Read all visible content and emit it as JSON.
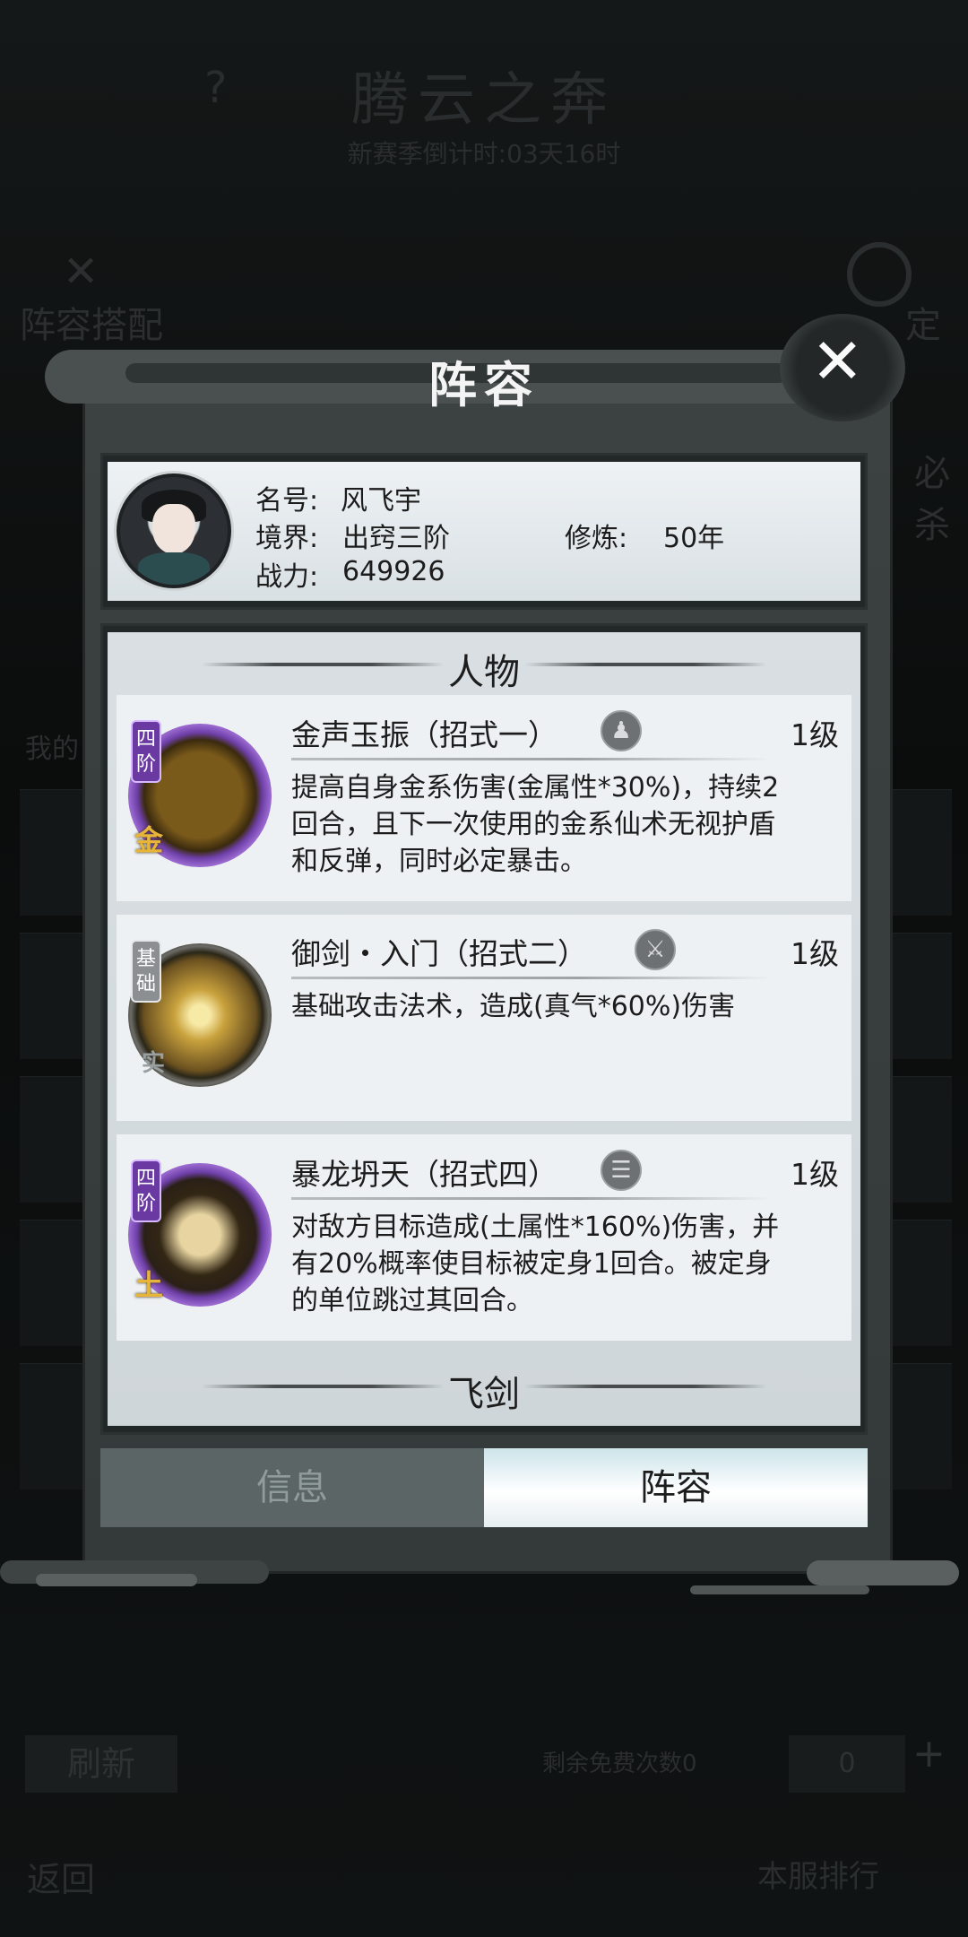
{
  "background": {
    "title": "腾云之奔",
    "question_mark": "?",
    "countdown": "新赛季倒计时:03天16时",
    "lineup_button": "阵容搭配",
    "right_label_1": "定",
    "right_label_2": "必杀",
    "me_label": "我的",
    "refresh_button": "刷新",
    "free_count_label": "剩余免费次数0",
    "count_value": "0",
    "plus_button": "+",
    "back_button": "返回",
    "rank_button": "本服排行"
  },
  "modal": {
    "title": "阵容",
    "close_icon": "close-x-icon",
    "profile": {
      "name_label": "名号:",
      "name_value": "风飞宇",
      "realm_label": "境界:",
      "realm_value": "出窍三阶",
      "cultivation_label": "修炼:",
      "cultivation_value": "50年",
      "power_label": "战力:",
      "power_value": "649926"
    },
    "section_character": "人物",
    "section_sword": "飞剑",
    "skills": [
      {
        "tag": "四阶",
        "element": "金",
        "name": "金声玉振（招式一）",
        "type_icon": "figure-icon",
        "level": "1级",
        "desc": "提高自身金系伤害(金属性*30%)，持续2回合，且下一次使用的金系仙术无视护盾和反弹，同时必定暴击。"
      },
      {
        "tag": "基础",
        "element": "实",
        "name": "御剑・入门（招式二）",
        "type_icon": "sword-icon",
        "level": "1级",
        "desc": "基础攻击法术，造成(真气*60%)伤害"
      },
      {
        "tag": "四阶",
        "element": "土",
        "name": "暴龙坍天（招式四）",
        "type_icon": "group-icon",
        "level": "1级",
        "desc": "对敌方目标造成(土属性*160%)伤害，并有20%概率使目标被定身1回合。被定身的单位跳过其回合。"
      }
    ],
    "tabs": {
      "info": "信息",
      "lineup": "阵容"
    }
  }
}
